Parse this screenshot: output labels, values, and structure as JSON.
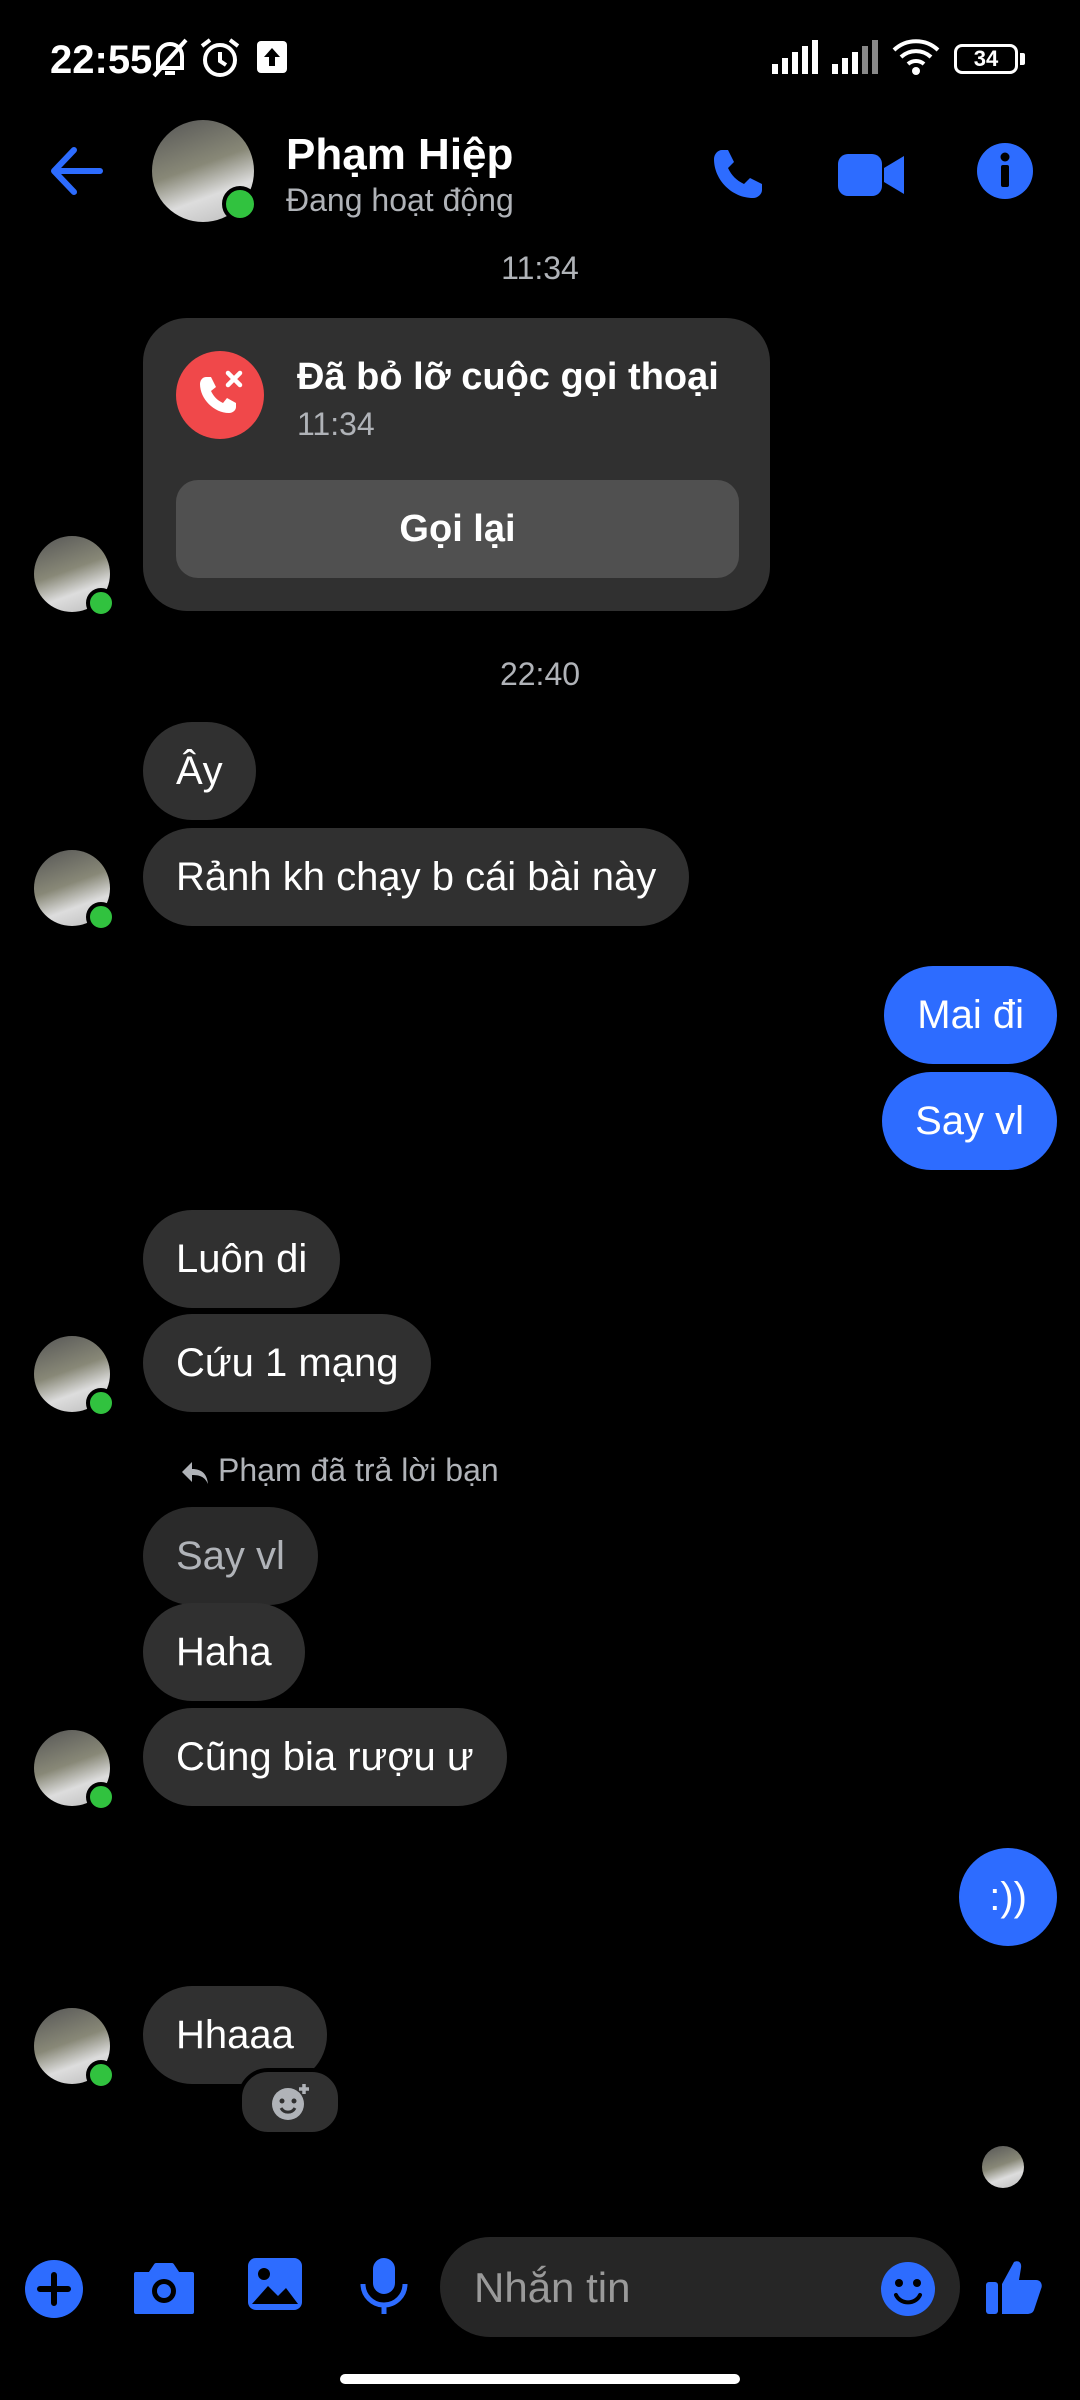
{
  "status_bar": {
    "time": "22:55",
    "battery": "34",
    "icons": [
      "mute-bell-icon",
      "alarm-icon",
      "upload-icon",
      "signal-icon",
      "signal-icon",
      "wifi-icon",
      "battery-icon"
    ]
  },
  "header": {
    "name": "Phạm Hiệp",
    "status": "Đang hoạt động",
    "icons": [
      "back-arrow-icon",
      "phone-icon",
      "video-camera-icon",
      "info-icon"
    ]
  },
  "call_card": {
    "title": "Đã bỏ lỡ cuộc gọi thoại",
    "time": "11:34",
    "button_label": "Gọi lại"
  },
  "timestamps": [
    "11:34",
    "22:40"
  ],
  "messages": [
    {
      "from": "them",
      "text": "Ây"
    },
    {
      "from": "them",
      "text": "Rảnh kh chạy b cái bài này"
    },
    {
      "from": "me",
      "text": "Mai đi"
    },
    {
      "from": "me",
      "text": "Say vl"
    },
    {
      "from": "them",
      "text": "Luôn di"
    },
    {
      "from": "them",
      "text": "Cứu 1 mạng"
    },
    {
      "from": "them",
      "text": "Haha"
    },
    {
      "from": "them",
      "text": "Cũng bia rượu ư"
    },
    {
      "from": "me",
      "text": ":))"
    },
    {
      "from": "them",
      "text": "Hhaaa"
    }
  ],
  "reply_notice": "Phạm đã trả lời bạn",
  "quoted_message": "Say vl",
  "composer": {
    "placeholder": "Nhắn tin",
    "icons": [
      "plus-icon",
      "camera-icon",
      "image-icon",
      "mic-icon",
      "emoji-icon",
      "thumbs-up-icon"
    ]
  },
  "colors": {
    "accent": "#2d6cff",
    "bubble_them": "#303030",
    "online": "#31c23f",
    "missed_call": "#f0484a",
    "background": "#000000"
  }
}
